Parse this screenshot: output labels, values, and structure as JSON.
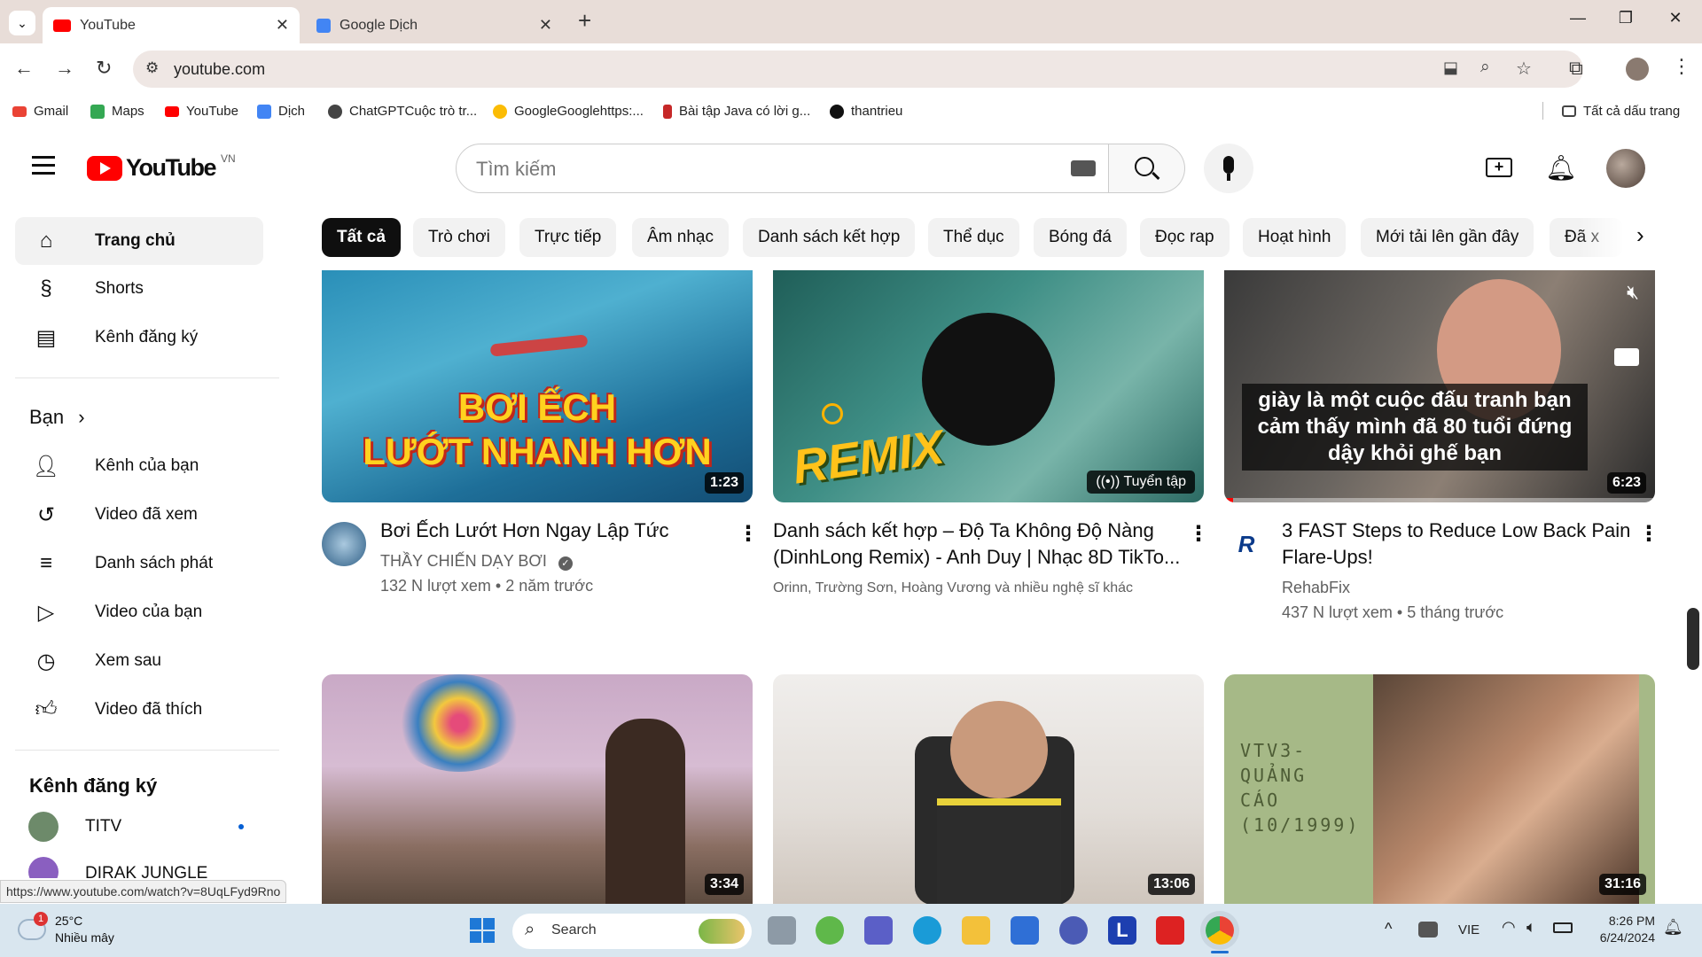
{
  "browser": {
    "tabs": [
      {
        "label": "YouTube",
        "active": true
      },
      {
        "label": "Google Dịch",
        "active": false
      }
    ],
    "new_tab": "+",
    "address": "youtube.com",
    "bookmarks": [
      "Gmail",
      "Maps",
      "YouTube",
      "Dịch",
      "ChatGPTCuộc trò tr...",
      "GoogleGooglehttps:...",
      "Bài tập Java có lời g...",
      "thantrieu"
    ],
    "all_bookmarks": "Tất cả dấu trang",
    "status_url": "https://www.youtube.com/watch?v=8UqLFyd9Rno"
  },
  "youtube": {
    "logo_text": "YouTube",
    "region": "VN",
    "search_placeholder": "Tìm kiếm",
    "chips": [
      "Tất cả",
      "Trò chơi",
      "Trực tiếp",
      "Âm nhạc",
      "Danh sách kết hợp",
      "Thể dục",
      "Bóng đá",
      "Đọc rap",
      "Hoạt hình",
      "Mới tải lên gần đây",
      "Đã x"
    ],
    "sidebar": {
      "main": [
        "Trang chủ",
        "Shorts",
        "Kênh đăng ký"
      ],
      "you_title": "Bạn",
      "you": [
        "Kênh của bạn",
        "Video đã xem",
        "Danh sách phát",
        "Video của bạn",
        "Xem sau",
        "Video đã thích"
      ],
      "subs_title": "Kênh đăng ký",
      "subs": [
        "TITV",
        "DIRAK JUNGLE"
      ]
    },
    "videos": [
      {
        "overlay": "BƠI ẾCH\nLƯỚT NHANH HƠN",
        "duration": "1:23",
        "title": "Bơi Ếch Lướt Hơn Ngay Lập Tức",
        "channel": "THẦY CHIẾN DẠY BƠI",
        "views": "132 N lượt xem",
        "age": "2 năm trước"
      },
      {
        "overlay": "REMIX",
        "badge": "Tuyển tập",
        "title": "Danh sách kết hợp – Độ Ta Không Độ Nàng (DinhLong Remix) - Anh Duy | Nhạc 8D TikTo...",
        "channel": "Orinn, Trường Sơn, Hoàng Vương và nhiều nghệ sĩ khác"
      },
      {
        "overlay": "giày là một cuộc đấu tranh bạn cảm thấy mình đã 80 tuổi đứng dậy khỏi ghế bạn",
        "duration": "6:23",
        "title": "3 FAST Steps to Reduce Low Back Pain Flare-Ups!",
        "channel": "RehabFix",
        "views": "437 N lượt xem",
        "age": "5 tháng trước"
      },
      {
        "duration": "3:34"
      },
      {
        "duration": "13:06"
      },
      {
        "overlay": "VTV3-\nQUẢNG\nCÁO\n(10/1999)",
        "duration": "31:16"
      }
    ]
  },
  "taskbar": {
    "weather_temp": "25°C",
    "weather_desc": "Nhiều mây",
    "weather_badge": "1",
    "search": "Search",
    "lang": "VIE",
    "time": "8:26 PM",
    "date": "6/24/2024"
  },
  "colors": {
    "yt_red": "#ff0000",
    "chrome_frame": "#e8ddd8",
    "taskbar": "#d9e6ef"
  }
}
